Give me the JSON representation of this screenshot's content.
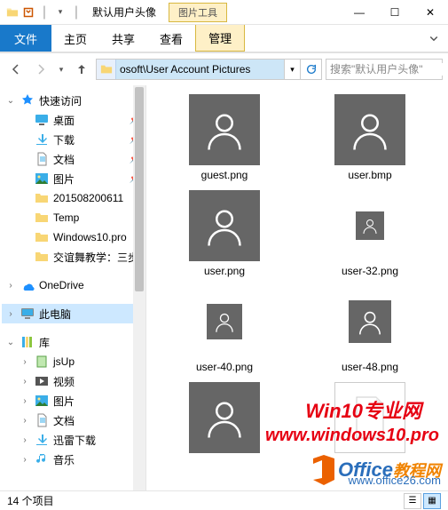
{
  "titlebar": {
    "title": "默认用户头像",
    "context_tool": "图片工具"
  },
  "window_controls": {
    "min": "—",
    "max": "☐",
    "close": "✕"
  },
  "ribbon": {
    "file": "文件",
    "tabs": [
      "主页",
      "共享",
      "查看"
    ],
    "context_tab": "管理"
  },
  "nav": {
    "address": "osoft\\User Account Pictures",
    "search_placeholder": "搜索\"默认用户头像\""
  },
  "tree": {
    "quick": {
      "label": "快速访问",
      "items": [
        {
          "label": "桌面",
          "pinned": true,
          "icon": "desktop"
        },
        {
          "label": "下载",
          "pinned": true,
          "icon": "downloads"
        },
        {
          "label": "文档",
          "pinned": true,
          "icon": "documents"
        },
        {
          "label": "图片",
          "pinned": true,
          "icon": "pictures"
        },
        {
          "label": "201508200611",
          "icon": "folder"
        },
        {
          "label": "Temp",
          "icon": "folder"
        },
        {
          "label": "Windows10.pro",
          "icon": "folder"
        },
        {
          "label": "交谊舞教学：三步",
          "icon": "folder"
        }
      ]
    },
    "onedrive": "OneDrive",
    "thispc": "此电脑",
    "libraries": {
      "label": "库",
      "items": [
        {
          "label": "jsUp",
          "icon": "lib"
        },
        {
          "label": "视频",
          "icon": "videos"
        },
        {
          "label": "图片",
          "icon": "pictures"
        },
        {
          "label": "文档",
          "icon": "documents"
        },
        {
          "label": "迅雷下载",
          "icon": "downloads"
        },
        {
          "label": "音乐",
          "icon": "music"
        }
      ]
    }
  },
  "files": [
    {
      "name": "guest.png",
      "size": "s80"
    },
    {
      "name": "user.bmp",
      "size": "s80"
    },
    {
      "name": "user.png",
      "size": "s80"
    },
    {
      "name": "user-32.png",
      "size": "s32"
    },
    {
      "name": "user-40.png",
      "size": "s40"
    },
    {
      "name": "user-48.png",
      "size": "s48"
    },
    {
      "name": "",
      "size": "s80"
    },
    {
      "name": "",
      "size": "blank"
    }
  ],
  "status": {
    "count": "14 个项目"
  },
  "watermark": {
    "line1": "Win10专业网",
    "line2": "www.windows10.pro",
    "office_blue": "Office",
    "office_orange": "教程网",
    "office_url": "www.office26.com"
  }
}
